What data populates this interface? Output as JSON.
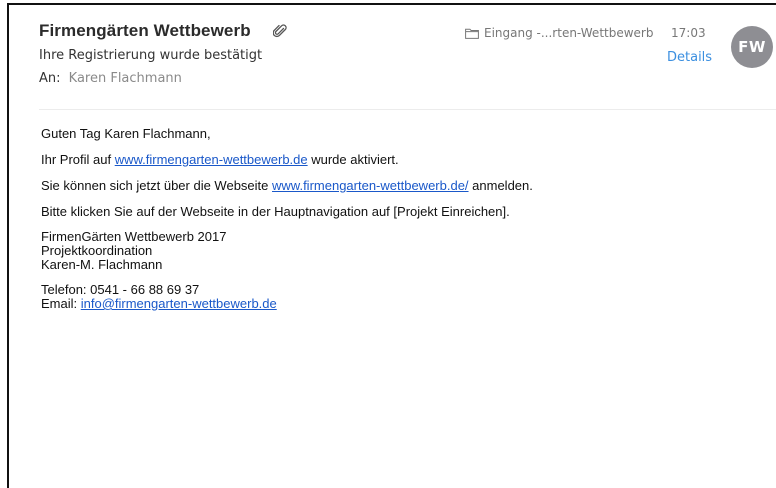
{
  "header": {
    "sender": "Firmengärten Wettbewerb",
    "subject": "Ihre Registrierung wurde bestätigt",
    "to_label": "An:",
    "to_value": "Karen Flachmann",
    "folder": "Eingang -...rten-Wettbewerb",
    "time": "17:03",
    "details_label": "Details",
    "avatar_initials": "FW",
    "avatar_color": "#8e8e93",
    "link_color": "#3b8fe0",
    "attachment_icon": "paperclip-icon",
    "folder_icon": "folder-icon"
  },
  "body": {
    "greeting": "Guten Tag Karen Flachmann,",
    "line1_pre": "Ihr Profil auf ",
    "line1_link": "www.firmengarten-wettbewerb.de",
    "line1_post": " wurde aktiviert.",
    "line2_pre": "Sie können sich jetzt über die Webseite ",
    "line2_link": "www.firmengarten-wettbewerb.de/",
    "line2_post": " anmelden.",
    "line3": "Bitte klicken Sie auf der Webseite in der Hauptnavigation auf [Projekt Einreichen].",
    "signature": [
      "FirmenGärten Wettbewerb 2017",
      "Projektkoordination",
      "Karen-M. Flachmann"
    ],
    "phone": "Telefon: 0541 - 66 88 69 37",
    "email_label": "Email: ",
    "email_link": "info@firmengarten-wettbewerb.de"
  }
}
